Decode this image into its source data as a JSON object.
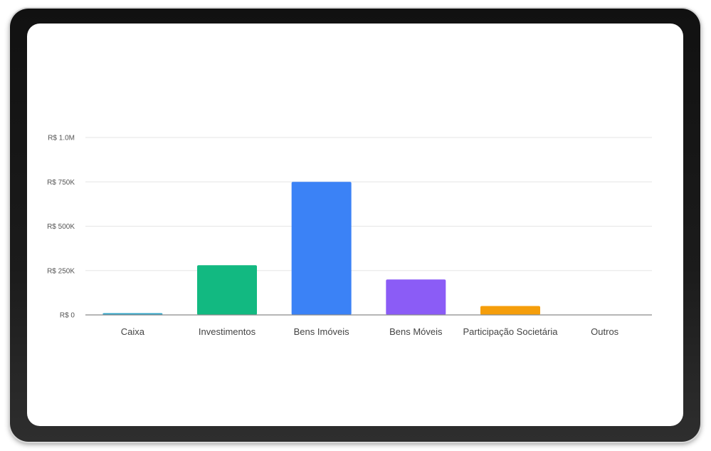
{
  "chart_data": {
    "type": "bar",
    "categories": [
      "Caixa",
      "Investimentos",
      "Bens Imóveis",
      "Bens Móveis",
      "Participação Societária",
      "Outros"
    ],
    "values": [
      10000,
      280000,
      750000,
      200000,
      50000,
      0
    ],
    "colors": [
      "#35a7c9",
      "#12b981",
      "#3b82f6",
      "#8b5cf6",
      "#f59e0b",
      "#cccccc"
    ],
    "ylim": [
      0,
      1000000
    ],
    "yticks": [
      {
        "value": 0,
        "label": "R$ 0"
      },
      {
        "value": 250000,
        "label": "R$ 250K"
      },
      {
        "value": 500000,
        "label": "R$ 500K"
      },
      {
        "value": 750000,
        "label": "R$ 750K"
      },
      {
        "value": 1000000,
        "label": "R$ 1.0M"
      }
    ],
    "grid": true,
    "legend": "none"
  }
}
